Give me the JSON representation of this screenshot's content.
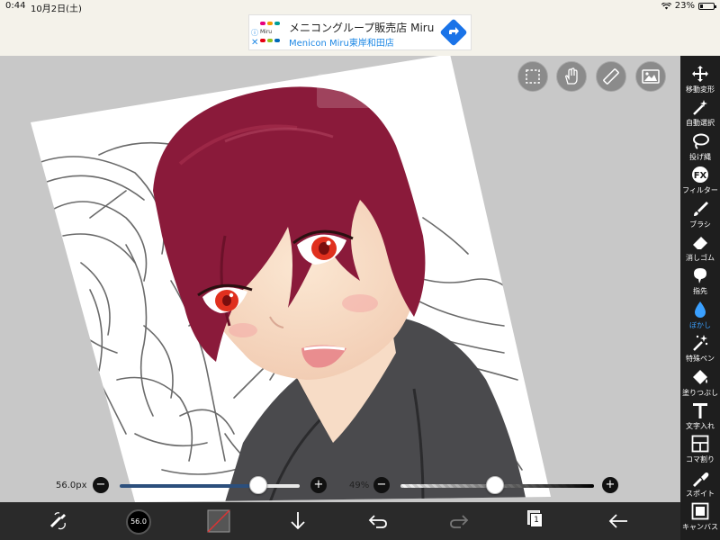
{
  "status_bar": {
    "time": "0:44",
    "date": "10月2日(土)",
    "battery": "23%",
    "battery_level": 0.23
  },
  "ad": {
    "brand": "Miru",
    "title": "メニコングループ販売店 Miru",
    "subtitle": "Menicon Miru東岸和田店",
    "info_icon": "info-icon",
    "close_icon": "close-icon"
  },
  "top_tools": [
    {
      "name": "selection-icon"
    },
    {
      "name": "hand-icon"
    },
    {
      "name": "ruler-icon"
    },
    {
      "name": "image-icon"
    }
  ],
  "right_tools": [
    {
      "label": "移動変形",
      "icon": "move-icon"
    },
    {
      "label": "自動選択",
      "icon": "magic-wand-icon"
    },
    {
      "label": "投げ縄",
      "icon": "lasso-icon"
    },
    {
      "label": "フィルター",
      "icon": "fx-icon"
    },
    {
      "label": "ブラシ",
      "icon": "brush-icon"
    },
    {
      "label": "消しゴム",
      "icon": "eraser-icon"
    },
    {
      "label": "指先",
      "icon": "smudge-icon"
    },
    {
      "label": "ぼかし",
      "icon": "blur-icon",
      "active": true
    },
    {
      "label": "特殊ペン",
      "icon": "special-pen-icon"
    },
    {
      "label": "塗りつぶし",
      "icon": "fill-icon"
    },
    {
      "label": "文字入れ",
      "icon": "text-icon"
    },
    {
      "label": "コマ割り",
      "icon": "frame-icon"
    },
    {
      "label": "スポイト",
      "icon": "eyedropper-icon"
    },
    {
      "label": "キャンバス",
      "icon": "canvas-icon"
    }
  ],
  "sliders": {
    "size": {
      "value": "56.0px",
      "level": 0.77,
      "minus": "−",
      "plus": "+"
    },
    "opacity": {
      "value": "49%",
      "level": 0.49,
      "minus": "−",
      "plus": "+"
    }
  },
  "bottom": {
    "brush_size": "56.0",
    "layer_count": "1"
  },
  "colors": {
    "toolbar_dark": "#1e1e1e",
    "bottom_dark": "#2a2a2a",
    "accent_blue": "#3aa0ff",
    "slider_blue": "#2c4f7c",
    "hair": "#8a1a3a",
    "eyes": "#e0301e"
  }
}
